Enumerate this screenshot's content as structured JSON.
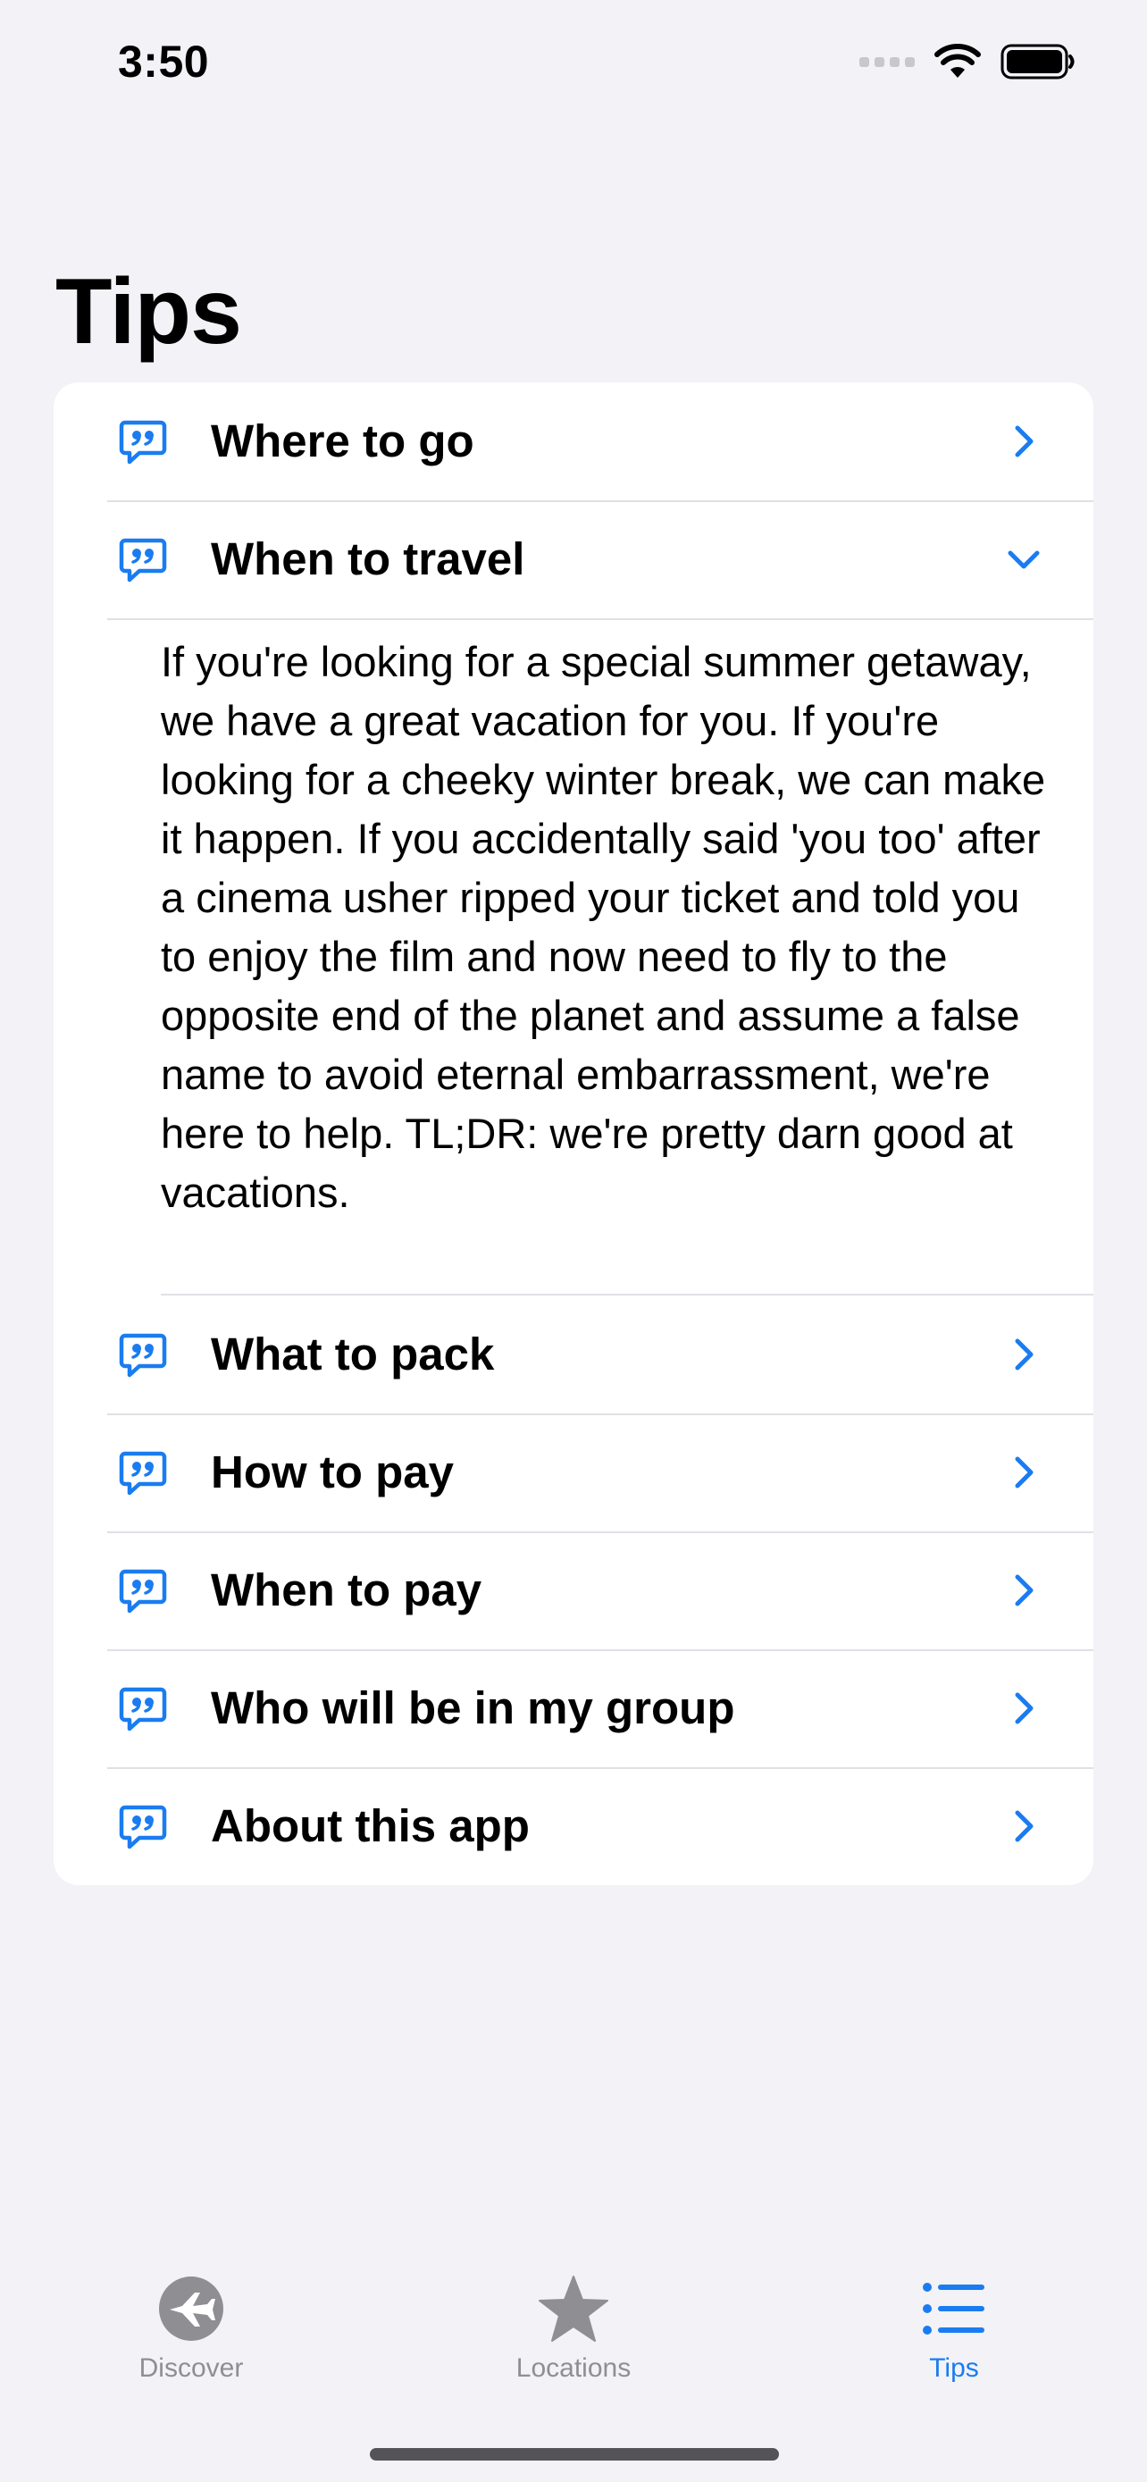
{
  "status_bar": {
    "time": "3:50"
  },
  "page_title": "Tips",
  "accent_color": "#1a7cf0",
  "tips": [
    {
      "label": "Where to go",
      "icon": "quote-bubble-icon",
      "expanded": false
    },
    {
      "label": "When to travel",
      "icon": "quote-bubble-icon",
      "expanded": true,
      "detail": "If you're looking for a special summer getaway, we have a great vacation for you. If you're looking for a cheeky winter break, we can make it happen. If you accidentally said 'you too' after a cinema usher ripped your ticket and told you to enjoy the film and now need to fly to the opposite end of the planet and assume a false name to avoid eternal embarrassment, we're here to help. TL;DR: we're pretty darn good at vacations."
    },
    {
      "label": "What to pack",
      "icon": "quote-bubble-icon",
      "expanded": false
    },
    {
      "label": "How to pay",
      "icon": "quote-bubble-icon",
      "expanded": false
    },
    {
      "label": "When to pay",
      "icon": "quote-bubble-icon",
      "expanded": false
    },
    {
      "label": "Who will be in my group",
      "icon": "quote-bubble-icon",
      "expanded": false
    },
    {
      "label": "About this app",
      "icon": "quote-bubble-icon",
      "expanded": false
    }
  ],
  "tabbar": {
    "tabs": [
      {
        "label": "Discover",
        "icon": "airplane-circle-icon",
        "active": false
      },
      {
        "label": "Locations",
        "icon": "star-icon",
        "active": false
      },
      {
        "label": "Tips",
        "icon": "list-icon",
        "active": true
      }
    ]
  }
}
